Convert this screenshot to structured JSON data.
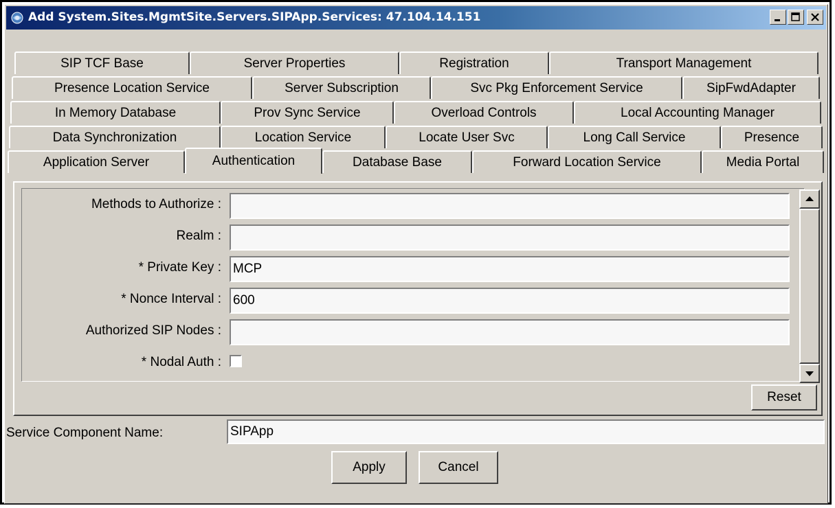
{
  "window": {
    "title": "Add System.Sites.MgmtSite.Servers.SIPApp.Services: 47.104.14.151",
    "icon": "window-app-icon",
    "controls": [
      "minimize",
      "maximize",
      "close"
    ]
  },
  "tabs": {
    "rows": [
      [
        "SIP TCF Base",
        "Server Properties",
        "Registration",
        "Transport Management"
      ],
      [
        "Presence Location Service",
        "Server Subscription",
        "Svc Pkg Enforcement Service",
        "SipFwdAdapter"
      ],
      [
        "In Memory Database",
        "Prov Sync Service",
        "Overload Controls",
        "Local Accounting Manager"
      ],
      [
        "Data Synchronization",
        "Location Service",
        "Locate User Svc",
        "Long Call Service",
        "Presence"
      ],
      [
        "Application Server",
        "Authentication",
        "Database Base",
        "Forward Location Service",
        "Media Portal"
      ]
    ],
    "active": "Authentication"
  },
  "form": {
    "fields": [
      {
        "label": "Methods to Authorize :",
        "value": ""
      },
      {
        "label": "Realm :",
        "value": ""
      },
      {
        "label": "* Private Key :",
        "value": "MCP"
      },
      {
        "label": "* Nonce Interval :",
        "value": "600"
      },
      {
        "label": "Authorized SIP Nodes :",
        "value": ""
      }
    ],
    "checkbox": {
      "label": "* Nodal Auth :",
      "checked": false
    },
    "reset_label": "Reset"
  },
  "service_component": {
    "label": "Service Component Name:",
    "value": "SIPApp"
  },
  "buttons": {
    "apply": "Apply",
    "cancel": "Cancel"
  }
}
